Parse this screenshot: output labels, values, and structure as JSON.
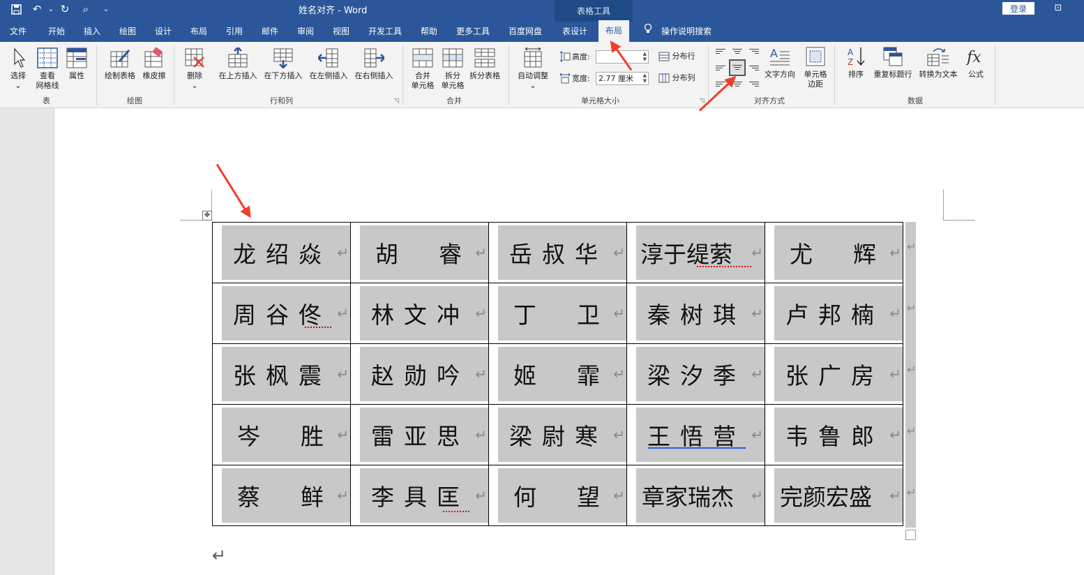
{
  "window": {
    "title": "姓名对齐 - Word",
    "contextual_group": "表格工具",
    "login_label": "登录",
    "restore_label": "⊡"
  },
  "quick_access": {
    "save": "▪",
    "undo": "↶",
    "undo_more": "⌄",
    "redo": "↻",
    "preview": "⌕",
    "customize": "⌄"
  },
  "tabs": [
    {
      "label": "文件"
    },
    {
      "label": "开始"
    },
    {
      "label": "插入"
    },
    {
      "label": "绘图"
    },
    {
      "label": "设计"
    },
    {
      "label": "布局"
    },
    {
      "label": "引用"
    },
    {
      "label": "邮件"
    },
    {
      "label": "审阅"
    },
    {
      "label": "视图"
    },
    {
      "label": "开发工具"
    },
    {
      "label": "帮助"
    },
    {
      "label": "更多工具"
    },
    {
      "label": "百度网盘"
    },
    {
      "label": "表设计"
    },
    {
      "label": "布局"
    },
    {
      "label": "操作说明搜索"
    }
  ],
  "ribbon": {
    "groups": {
      "table": "表",
      "draw": "绘图",
      "rows_cols": "行和列",
      "merge": "合并",
      "cell_size": "单元格大小",
      "alignment": "对齐方式",
      "data": "数据"
    },
    "buttons": {
      "select": "选择",
      "select_arrow": "⌄",
      "gridlines_1": "查看",
      "gridlines_2": "网格线",
      "properties": "属性",
      "draw_table": "绘制表格",
      "eraser": "橡皮擦",
      "delete": "删除",
      "delete_arrow": "⌄",
      "insert_above": "在上方插入",
      "insert_below": "在下方插入",
      "insert_left": "在左侧插入",
      "insert_right": "在右侧插入",
      "merge_1": "合并",
      "merge_2": "单元格",
      "split_1": "拆分",
      "split_2": "单元格",
      "split_table": "拆分表格",
      "autofit": "自动调整",
      "autofit_arrow": "⌄",
      "height_label": "高度:",
      "height_value": "",
      "width_label": "宽度:",
      "width_value": "2.77 厘米",
      "dist_rows": "分布行",
      "dist_cols": "分布列",
      "text_direction": "文字方向",
      "margins_1": "单元格",
      "margins_2": "边距",
      "sort": "排序",
      "repeat_header": "重复标题行",
      "convert_text": "转换为文本",
      "formula": "公式"
    }
  },
  "names": [
    [
      "龙绍焱",
      "胡睿",
      "岳叔华",
      "淳于缇萦",
      "尤辉"
    ],
    [
      "周谷佟",
      "林文冲",
      "丁卫",
      "秦树琪",
      "卢邦楠"
    ],
    [
      "张枫震",
      "赵勋吟",
      "姬霏",
      "梁汐季",
      "张广房"
    ],
    [
      "岑胜",
      "雷亚思",
      "梁尉寒",
      "王悟营",
      "韦鲁郎"
    ],
    [
      "蔡鲜",
      "李具匡",
      "何望",
      "章家瑞杰",
      "完颜宏盛"
    ]
  ],
  "marks": {
    "cell_return": "↵",
    "para": "↵",
    "move_handle": "✥"
  },
  "colors": {
    "title_bar": "#2b579a",
    "cell_shading": "#c8c8c8",
    "arrow": "#f23c2c",
    "ribbon_bg": "#f3f3f3"
  }
}
